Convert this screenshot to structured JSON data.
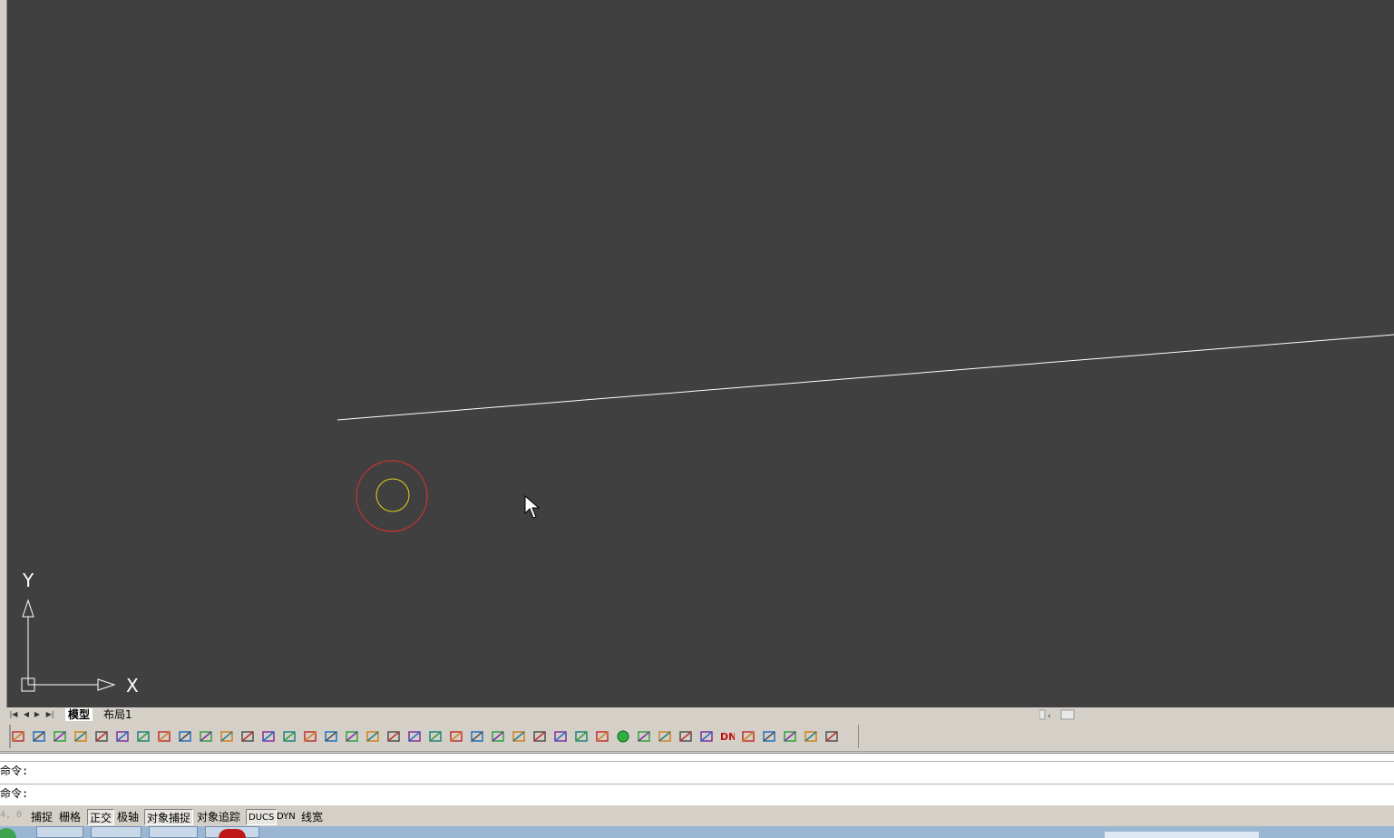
{
  "canvas": {
    "background": "#404040"
  },
  "ucs": {
    "y_label": "Y",
    "x_label": "X"
  },
  "layout_tabs": {
    "model": "模型",
    "layout1": "布局1"
  },
  "command_lines": [
    "命令:",
    "命令:"
  ],
  "status": {
    "coords": "4, 0",
    "snap": "捕捉",
    "grid": "栅格",
    "ortho": "正交",
    "polar": "极轴",
    "osnap": "对象捕捉",
    "otrack": "对象追踪",
    "ducs": "DUCS",
    "dyn": "DYN",
    "lineweight": "线宽"
  },
  "toolbar_icons": [
    "layer-manager-icon",
    "layer-state-icon",
    "layer-match-icon",
    "layer-iso-icon",
    "save-icon",
    "zoom-window-icon",
    "pipe-icon",
    "arc-pipe-icon",
    "pen-icon",
    "level-icon",
    "elevation-icon",
    "list-icon",
    "valve-icon",
    "tap-icon",
    "fitting-icon",
    "grid-table-icon",
    "branch-icon",
    "link-icon",
    "block-icon",
    "box-icon",
    "dim-icon",
    "edit-icon",
    "text-icon",
    "table-icon",
    "scale-icon",
    "node-icon",
    "terrain-icon",
    "attribute-icon",
    "line-icon",
    "sphere-icon",
    "cube-icon",
    "solid-icon",
    "section-icon",
    "arrow-icon",
    "dn-label-icon",
    "slope-icon",
    "select-icon",
    "column-icon",
    "elevation-bar-icon",
    "axis-icon"
  ],
  "toolbar_text": {
    "dn": "DN"
  },
  "colors": {
    "circle_outer": "#e03030",
    "circle_inner": "#e0d020",
    "line": "#ffffff"
  }
}
